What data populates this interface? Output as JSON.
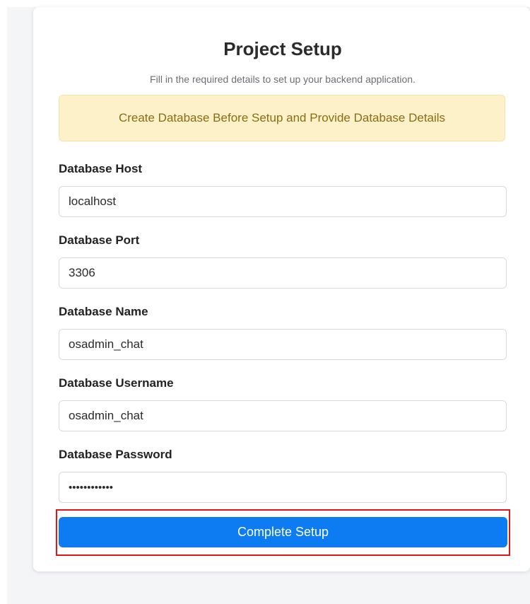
{
  "header": {
    "title": "Project Setup",
    "subtitle": "Fill in the required details to set up your backend application."
  },
  "alert": {
    "message": "Create Database Before Setup and Provide Database Details",
    "background": "#fdf1c9",
    "text_color": "#8a6d12"
  },
  "form": {
    "fields": [
      {
        "label": "Database Host",
        "value": "localhost"
      },
      {
        "label": "Database Port",
        "value": "3306"
      },
      {
        "label": "Database Name",
        "value": "osadmin_chat"
      },
      {
        "label": "Database Username",
        "value": "osadmin_chat"
      },
      {
        "label": "Database Password",
        "value": "••••••••••••"
      }
    ],
    "submit_label": "Complete Setup",
    "submit_color": "#0d7cf2",
    "highlight_color": "#e3151a"
  }
}
